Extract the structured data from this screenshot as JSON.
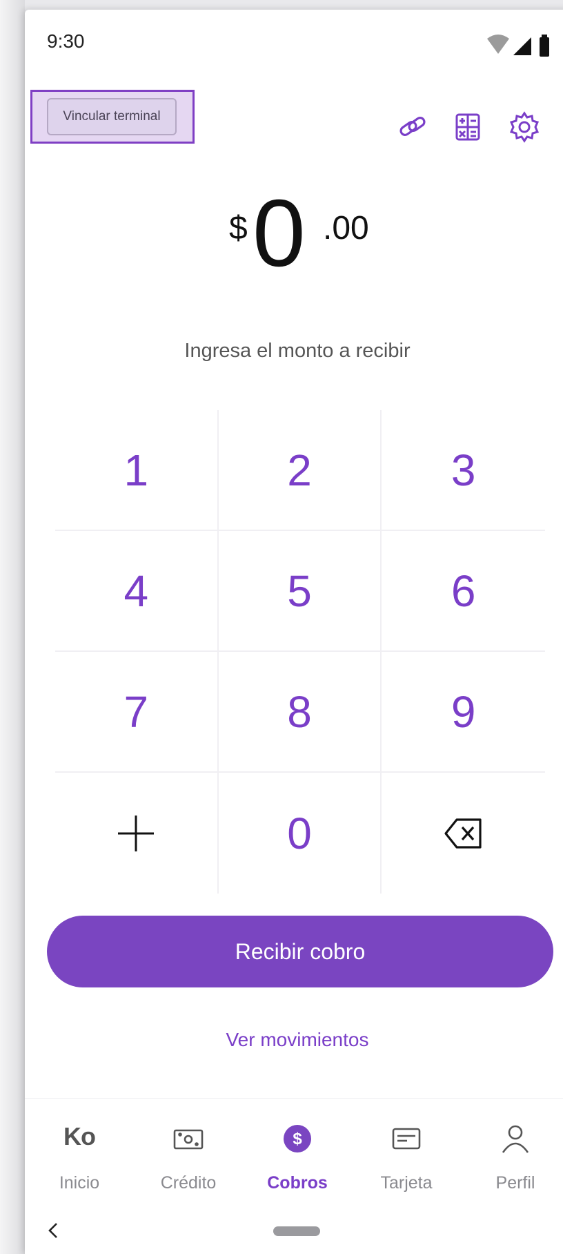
{
  "status_bar": {
    "time": "9:30"
  },
  "header": {
    "link_terminal_label": "Vincular terminal",
    "icons": [
      "link-icon",
      "calculator-icon",
      "gear-icon"
    ]
  },
  "amount": {
    "currency": "$",
    "integer": "0",
    "decimals": ".00"
  },
  "prompt": "Ingresa el monto a recibir",
  "keypad": {
    "keys": [
      "1",
      "2",
      "3",
      "4",
      "5",
      "6",
      "7",
      "8",
      "9",
      "0"
    ],
    "plus_icon": "plus-icon",
    "backspace_icon": "backspace-icon"
  },
  "actions": {
    "primary": "Recibir cobro",
    "secondary": "Ver movimientos"
  },
  "nav": {
    "logo": "Ko",
    "items": [
      {
        "label": "Inicio",
        "icon": "ko-logo"
      },
      {
        "label": "Crédito",
        "icon": "cash-icon"
      },
      {
        "label": "Cobros",
        "icon": "dollar-icon",
        "active": true
      },
      {
        "label": "Tarjeta",
        "icon": "card-icon"
      },
      {
        "label": "Perfil",
        "icon": "user-icon"
      }
    ]
  },
  "colors": {
    "accent": "#7a45c1",
    "text": "#111111",
    "muted": "#8a8a8f"
  }
}
